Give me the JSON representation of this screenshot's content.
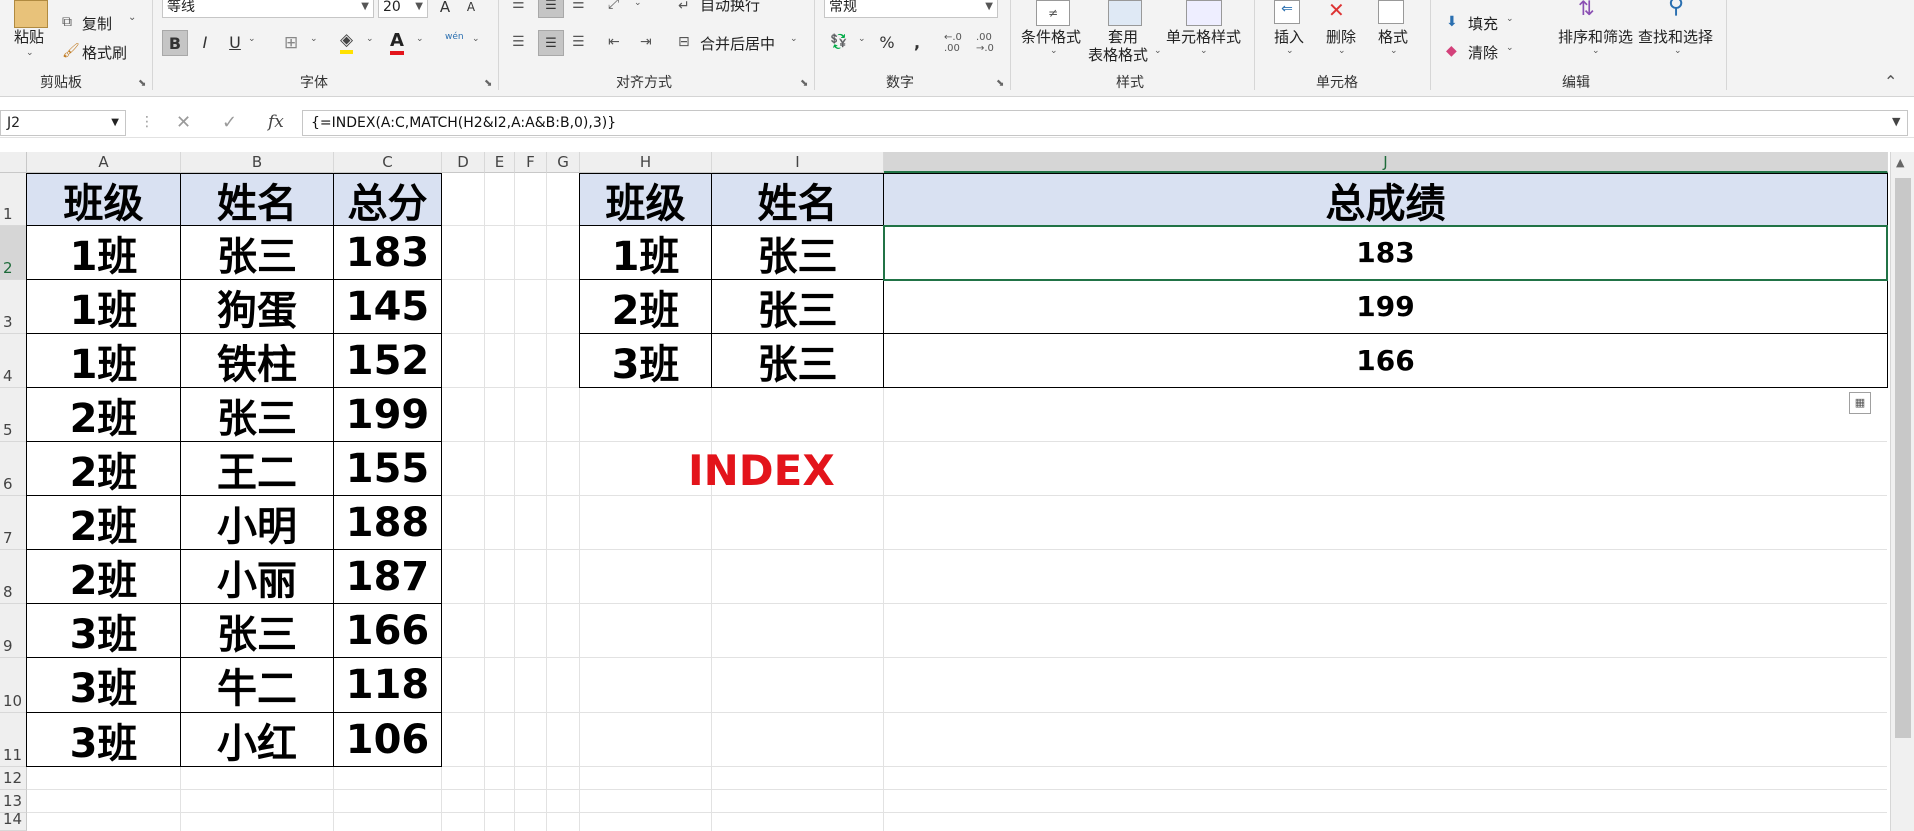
{
  "ribbon": {
    "clipboard": {
      "paste_label": "粘贴",
      "copy_label": "复制",
      "format_painter_label": "格式刷",
      "group_label": "剪贴板"
    },
    "font": {
      "font_name": "等线",
      "font_size": "20",
      "bold": "B",
      "italic": "I",
      "underline": "U",
      "grow": "A",
      "shrink": "A",
      "font_color": "A",
      "phonetic": "wén",
      "group_label": "字体"
    },
    "alignment": {
      "wrap_text_label": "自动换行",
      "merge_center_label": "合并后居中",
      "group_label": "对齐方式"
    },
    "number": {
      "format_value": "常规",
      "percent": "%",
      "comma": ",",
      "group_label": "数字"
    },
    "styles": {
      "conditional_label": "条件格式",
      "table_format_label_1": "套用",
      "table_format_label_2": "表格格式",
      "cell_styles_label": "单元格样式",
      "group_label": "样式"
    },
    "cells": {
      "insert_label": "插入",
      "delete_label": "删除",
      "format_label": "格式",
      "group_label": "单元格"
    },
    "editing": {
      "fill_label": "填充",
      "clear_label": "清除",
      "sort_filter_label": "排序和筛选",
      "find_select_label": "查找和选择",
      "group_label": "编辑"
    }
  },
  "formula_bar": {
    "name_box": "J2",
    "fx": "fx",
    "formula": "{=INDEX(A:C,MATCH(H2&I2,A:A&B:B,0),3)}"
  },
  "columns": [
    "A",
    "B",
    "C",
    "D",
    "E",
    "F",
    "G",
    "H",
    "I",
    "J"
  ],
  "rows": [
    "1",
    "2",
    "3",
    "4",
    "5",
    "6",
    "7",
    "8",
    "9",
    "10",
    "11",
    "12",
    "13",
    "14"
  ],
  "left_table": {
    "headers": [
      "班级",
      "姓名",
      "总分"
    ],
    "rows": [
      [
        "1班",
        "张三",
        "183"
      ],
      [
        "1班",
        "狗蛋",
        "145"
      ],
      [
        "1班",
        "铁柱",
        "152"
      ],
      [
        "2班",
        "张三",
        "199"
      ],
      [
        "2班",
        "王二",
        "155"
      ],
      [
        "2班",
        "小明",
        "188"
      ],
      [
        "2班",
        "小丽",
        "187"
      ],
      [
        "3班",
        "张三",
        "166"
      ],
      [
        "3班",
        "牛二",
        "118"
      ],
      [
        "3班",
        "小红",
        "106"
      ]
    ]
  },
  "right_table": {
    "headers": [
      "班级",
      "姓名",
      "总成绩"
    ],
    "rows": [
      [
        "1班",
        "张三",
        "183"
      ],
      [
        "2班",
        "张三",
        "199"
      ],
      [
        "3班",
        "张三",
        "166"
      ]
    ]
  },
  "annotation": "INDEX",
  "colors": {
    "header_fill": "#d9e1f2",
    "annotation": "#e3141b",
    "selection": "#217346"
  }
}
